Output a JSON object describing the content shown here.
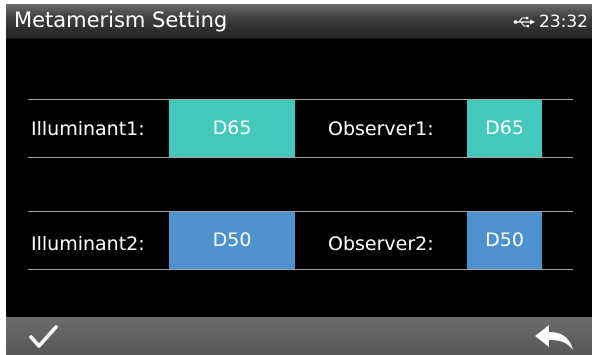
{
  "header": {
    "title": "Metamerism Setting",
    "usb_icon": "usb-icon",
    "time": "23:32"
  },
  "rows": [
    {
      "illuminant_label": "Illuminant1:",
      "illuminant_value": "D65",
      "observer_label": "Observer1:",
      "observer_value": "D65",
      "color": "#43c9bb"
    },
    {
      "illuminant_label": "Illuminant2:",
      "illuminant_value": "D50",
      "observer_label": "Observer2:",
      "observer_value": "D50",
      "color": "#4d91cf"
    }
  ],
  "footer": {
    "confirm_icon": "checkmark-icon",
    "back_icon": "back-arrow-icon"
  },
  "colors": {
    "background": "#000000",
    "teal_button": "#43c9bb",
    "blue_button": "#4d91cf",
    "divider": "#a5a5a5",
    "bottom_bar": "#636363"
  }
}
